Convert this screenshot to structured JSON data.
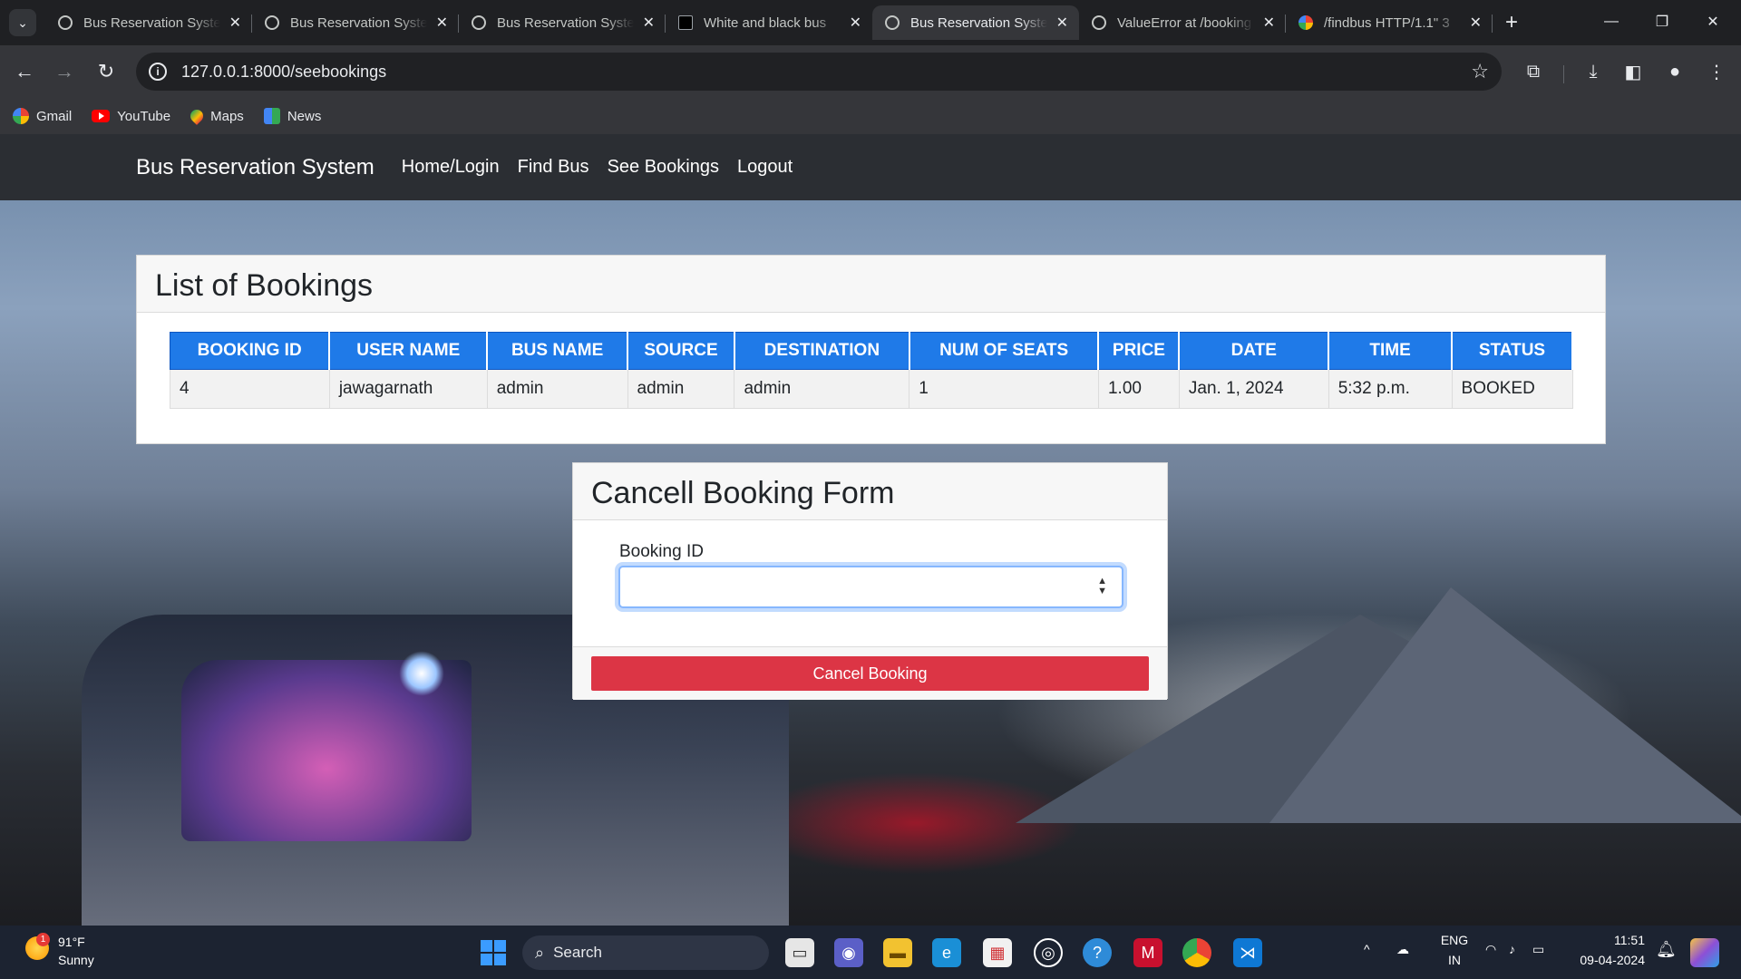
{
  "browser": {
    "tabs": [
      {
        "title": "Bus Reservation System",
        "icon": "globe-icon",
        "active": false
      },
      {
        "title": "Bus Reservation System",
        "icon": "globe-icon",
        "active": false
      },
      {
        "title": "Bus Reservation System",
        "icon": "globe-icon",
        "active": false
      },
      {
        "title": "White and black bus",
        "icon": "square-favicon-icon",
        "active": false
      },
      {
        "title": "Bus Reservation System",
        "icon": "globe-icon",
        "active": true
      },
      {
        "title": "ValueError at /booking",
        "icon": "globe-icon",
        "active": false
      },
      {
        "title": "/findbus HTTP/1.1\" 3",
        "icon": "google-icon",
        "active": false
      }
    ],
    "url": "127.0.0.1:8000/seebookings",
    "bookmarks": [
      {
        "label": "Gmail",
        "icon": "google-icon"
      },
      {
        "label": "YouTube",
        "icon": "youtube-icon"
      },
      {
        "label": "Maps",
        "icon": "maps-icon"
      },
      {
        "label": "News",
        "icon": "news-icon"
      }
    ]
  },
  "site": {
    "brand": "Bus Reservation System",
    "nav": [
      "Home/Login",
      "Find Bus",
      "See Bookings",
      "Logout"
    ]
  },
  "bookings": {
    "title": "List of Bookings",
    "columns": [
      "BOOKING ID",
      "USER NAME",
      "BUS NAME",
      "SOURCE",
      "DESTINATION",
      "NUM OF SEATS",
      "PRICE",
      "DATE",
      "TIME",
      "STATUS"
    ],
    "rows": [
      [
        "4",
        "jawagarnath",
        "admin",
        "admin",
        "admin",
        "1",
        "1.00",
        "Jan. 1, 2024",
        "5:32 p.m.",
        "BOOKED"
      ]
    ]
  },
  "cancel_form": {
    "title": "Cancell Booking Form",
    "field_label": "Booking ID",
    "field_value": "",
    "submit_label": "Cancel Booking"
  },
  "taskbar": {
    "weather_temp": "91°F",
    "weather_desc": "Sunny",
    "weather_badge": "1",
    "search_label": "Search",
    "lang_top": "ENG",
    "lang_bottom": "IN",
    "time": "11:51",
    "date": "09-04-2024"
  },
  "colors": {
    "table_header": "#1f7ae8",
    "danger_button": "#dc3545",
    "navbar": "#2b2e33"
  }
}
